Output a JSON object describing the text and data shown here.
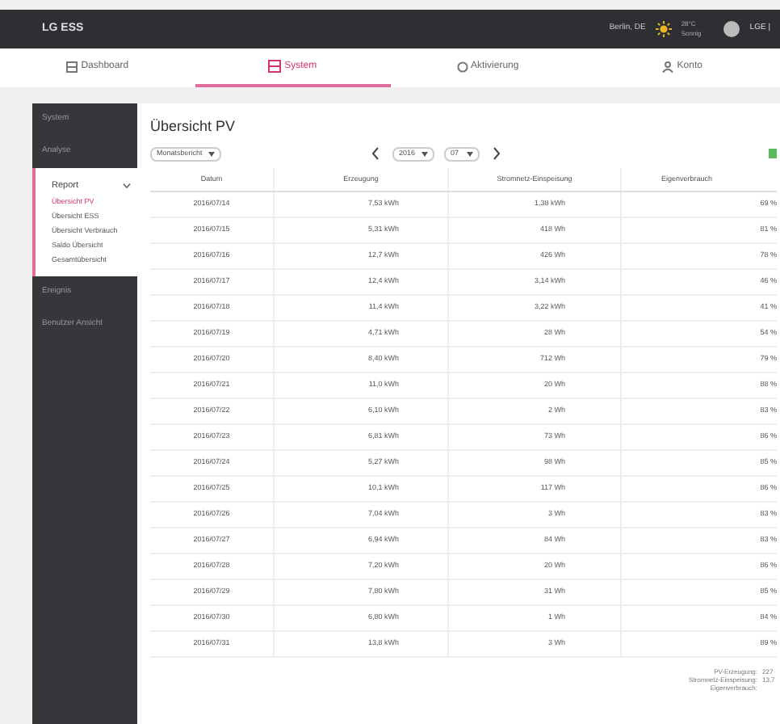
{
  "header": {
    "logo": "LG ESS",
    "location": "Berlin, DE",
    "weather_lines": [
      "28°C",
      "Sonnig"
    ],
    "user": "LGE |"
  },
  "tabs": [
    {
      "label": "Dashboard",
      "selected": false
    },
    {
      "label": "System",
      "selected": true
    },
    {
      "label": "Aktivierung",
      "selected": false
    },
    {
      "label": "Konto",
      "selected": false
    }
  ],
  "sidebar": {
    "items": [
      {
        "label": "System",
        "expanded": false
      },
      {
        "label": "Analyse",
        "expanded": false
      },
      {
        "label": "Report",
        "expanded": true,
        "children": [
          {
            "label": "Übersicht PV",
            "selected": true
          },
          {
            "label": "Übersicht ESS",
            "selected": false
          },
          {
            "label": "Übersicht Verbrauch",
            "selected": false
          },
          {
            "label": "Saldo Übersicht",
            "selected": false
          },
          {
            "label": "Gesamtübersicht",
            "selected": false
          }
        ]
      },
      {
        "label": "Ereignis",
        "expanded": false
      },
      {
        "label": "Benutzer Ansicht",
        "expanded": false
      }
    ]
  },
  "page_title": "Übersicht PV",
  "report_select": "Monatsbericht",
  "year_select": "2016",
  "month_select": "07",
  "table": {
    "columns": [
      "Datum",
      "Erzeugung",
      "Stromnetz-Einspeisung",
      "Eigenverbrauch"
    ],
    "rows": [
      [
        "2016/07/14",
        "7,53 kWh",
        "1,38 kWh",
        "69 %"
      ],
      [
        "2016/07/15",
        "5,31 kWh",
        "418 Wh",
        "81 %"
      ],
      [
        "2016/07/16",
        "12,7 kWh",
        "426 Wh",
        "78 %"
      ],
      [
        "2016/07/17",
        "12,4 kWh",
        "3,14 kWh",
        "46 %"
      ],
      [
        "2016/07/18",
        "11,4 kWh",
        "3,22 kWh",
        "41 %"
      ],
      [
        "2016/07/19",
        "4,71 kWh",
        "28 Wh",
        "54 %"
      ],
      [
        "2016/07/20",
        "8,40 kWh",
        "712 Wh",
        "79 %"
      ],
      [
        "2016/07/21",
        "11,0 kWh",
        "20 Wh",
        "88 %"
      ],
      [
        "2016/07/22",
        "6,10 kWh",
        "2 Wh",
        "83 %"
      ],
      [
        "2016/07/23",
        "6,81 kWh",
        "73 Wh",
        "86 %"
      ],
      [
        "2016/07/24",
        "5,27 kWh",
        "98 Wh",
        "85 %"
      ],
      [
        "2016/07/25",
        "10,1 kWh",
        "117 Wh",
        "86 %"
      ],
      [
        "2016/07/26",
        "7,04 kWh",
        "3 Wh",
        "83 %"
      ],
      [
        "2016/07/27",
        "6,94 kWh",
        "84 Wh",
        "83 %"
      ],
      [
        "2016/07/28",
        "7,20 kWh",
        "20 Wh",
        "86 %"
      ],
      [
        "2016/07/29",
        "7,80 kWh",
        "31 Wh",
        "85 %"
      ],
      [
        "2016/07/30",
        "6,80 kWh",
        "1 Wh",
        "84 %"
      ],
      [
        "2016/07/31",
        "13,8 kWh",
        "3 Wh",
        "89 %"
      ]
    ]
  },
  "summary": [
    {
      "label": "PV-Erzeugung:",
      "value": "227"
    },
    {
      "label": "Stromnetz-Einspeisung:",
      "value": "13,7"
    },
    {
      "label": "Eigenverbrauch:"
    }
  ]
}
